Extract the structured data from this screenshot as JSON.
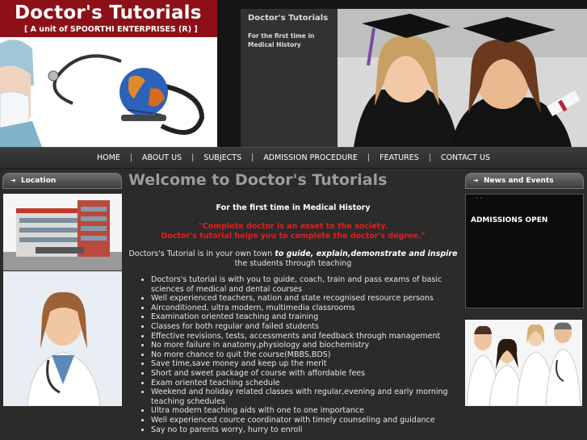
{
  "logo": {
    "title": "Doctor's Tutorials",
    "subtitle": "[ A unit of SPOORTHI ENTERPRISES (R) ]"
  },
  "banner": {
    "title": "Doctor's Tutorials",
    "subtitle_line1": "For the first time in",
    "subtitle_line2": "Medical History"
  },
  "nav": {
    "items": [
      "HOME",
      "ABOUT US",
      "SUBJECTS",
      "ADMISSION PROCEDURE",
      "FEATURES",
      "CONTACT US"
    ],
    "separator": "|"
  },
  "left_sidebar": {
    "heading": "Location",
    "arrow_icon": "arrow-right-icon"
  },
  "right_sidebar": {
    "heading": "News and Events",
    "arrow_icon": "arrow-right-icon",
    "news_marker": "· ·",
    "news_item": "ADMISSIONS OPEN"
  },
  "main": {
    "heading": "Welcome to Doctor's Tutorials",
    "first_time": "For the first time in Medical History",
    "quote_line1": "\"Complete doctor is an asset to the society.",
    "quote_line2": "Doctor's tutorial helps you to complete the doctor's degree.\"",
    "intro_prefix": "Doctors's Tutorial is in your own town ",
    "intro_bold": "to guide, explain,demonstrate and inspire",
    "intro_suffix": " the students through teaching",
    "features": [
      "Doctors's tutorial is with you to guide, coach, train and pass exams of basic sciences of medical and dental courses",
      "Well experienced teachers, nation and state recognised resource persons",
      "Airconditioned, ultra modern, multimedia classrooms",
      "Examination oriented teaching and training",
      "Classes for both regular and failed students",
      "Effective revisions, tests, accessments and feedback through management",
      "No more failure in anatomy,physiology and biochemistry",
      "No more chance to quit the course(MBBS,BDS)",
      "Save time,save money and keep up the merit",
      "Short and sweet package of course with affordable fees",
      "Exam oriented teaching schedule",
      "Weekend and holiday related classes with regular,evening and early morning teaching schedules",
      "Ultra modern teaching aids with one to one importance",
      "Well experienced cource coordinator with timely counseling and guidance",
      "Say no to parents worry, hurry to enroll"
    ]
  },
  "colors": {
    "brand_red": "#8d1018",
    "quote_red": "#e51d1d",
    "page_bg": "#2b2b2b",
    "heading_gray": "#9c9c9c"
  }
}
